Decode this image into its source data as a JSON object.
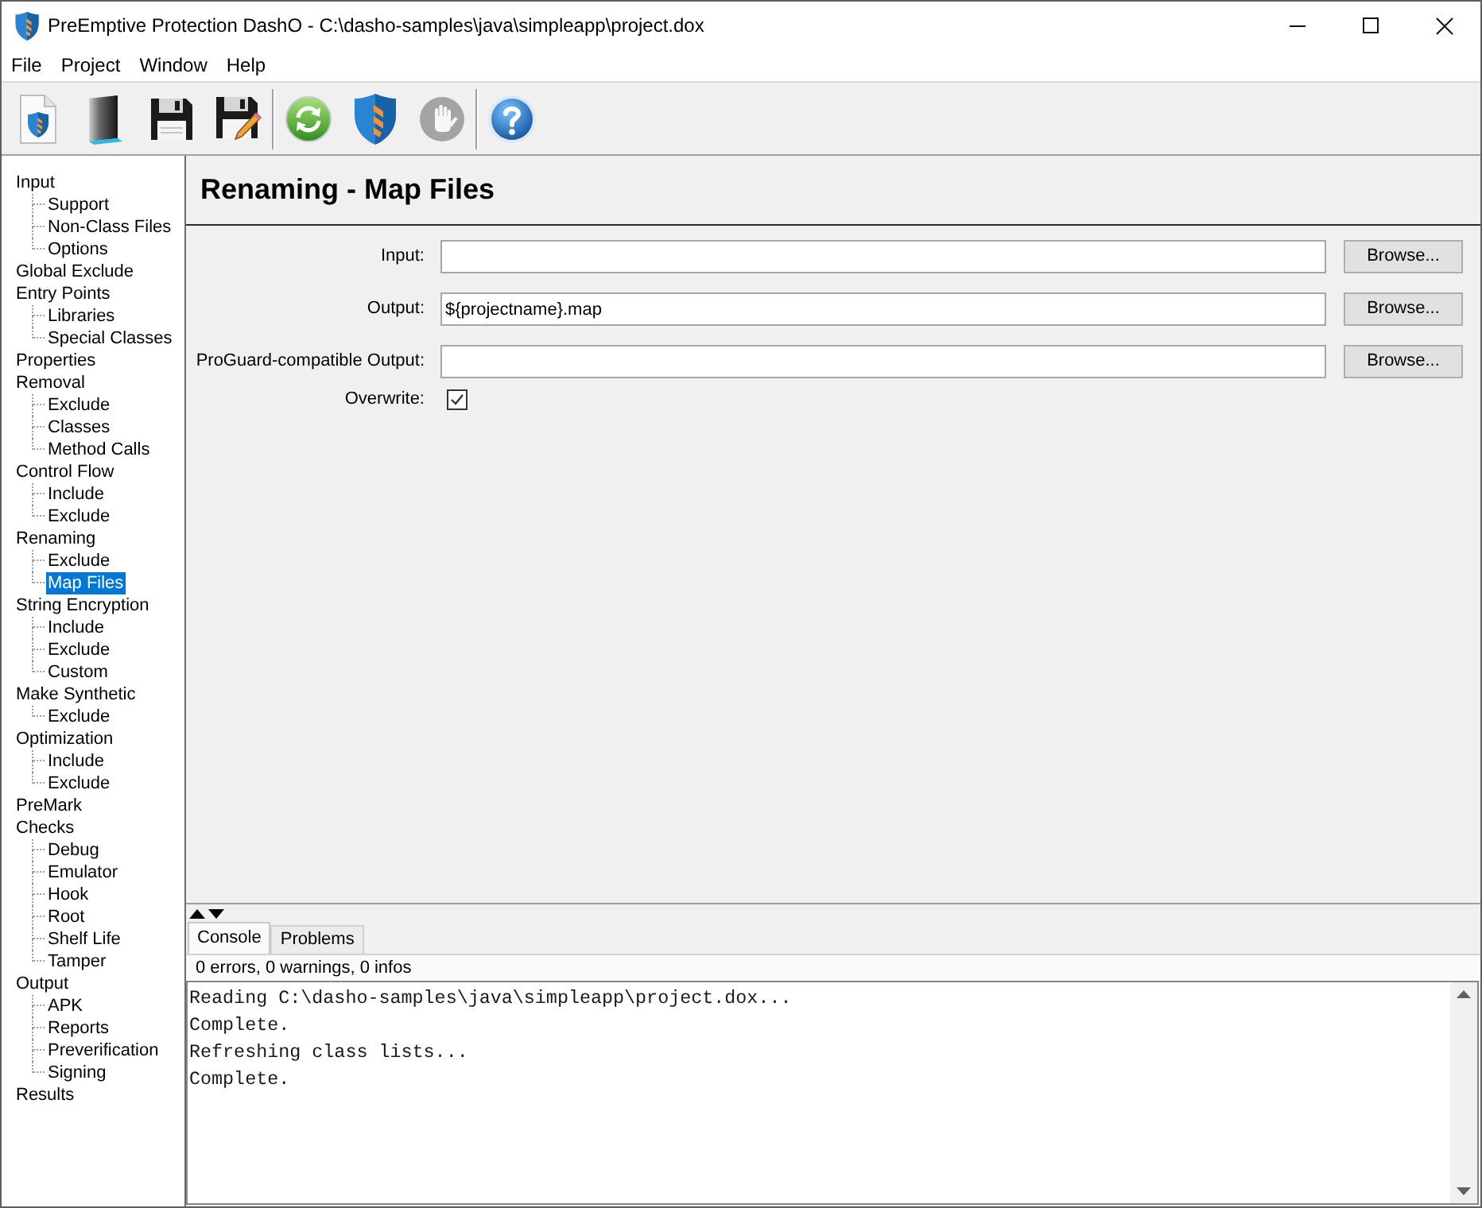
{
  "window": {
    "title": "PreEmptive Protection DashO - C:\\dasho-samples\\java\\simpleapp\\project.dox"
  },
  "menu": [
    {
      "label": "File"
    },
    {
      "label": "Project"
    },
    {
      "label": "Window"
    },
    {
      "label": "Help"
    }
  ],
  "toolbar_groups": [
    {
      "buttons": [
        {
          "kind": "new",
          "disabled": false
        },
        {
          "kind": "open",
          "disabled": false
        },
        {
          "kind": "save",
          "disabled": false
        },
        {
          "kind": "saveas",
          "disabled": false
        }
      ]
    },
    {
      "buttons": [
        {
          "kind": "refresh",
          "disabled": false
        },
        {
          "kind": "build",
          "disabled": false
        },
        {
          "kind": "stop",
          "disabled": true
        }
      ]
    },
    {
      "buttons": [
        {
          "kind": "help",
          "disabled": false
        }
      ]
    }
  ],
  "tree": [
    {
      "label": "Input",
      "selected": false,
      "children": [
        {
          "label": "Support",
          "selected": false
        },
        {
          "label": "Non-Class Files",
          "selected": false
        },
        {
          "label": "Options",
          "selected": false
        }
      ]
    },
    {
      "label": "Global Exclude",
      "selected": false
    },
    {
      "label": "Entry Points",
      "selected": false,
      "children": [
        {
          "label": "Libraries",
          "selected": false
        },
        {
          "label": "Special Classes",
          "selected": false
        }
      ]
    },
    {
      "label": "Properties",
      "selected": false
    },
    {
      "label": "Removal",
      "selected": false,
      "children": [
        {
          "label": "Exclude",
          "selected": false
        },
        {
          "label": "Classes",
          "selected": false
        },
        {
          "label": "Method Calls",
          "selected": false
        }
      ]
    },
    {
      "label": "Control Flow",
      "selected": false,
      "children": [
        {
          "label": "Include",
          "selected": false
        },
        {
          "label": "Exclude",
          "selected": false
        }
      ]
    },
    {
      "label": "Renaming",
      "selected": false,
      "children": [
        {
          "label": "Exclude",
          "selected": false
        },
        {
          "label": "Map Files",
          "selected": true
        }
      ]
    },
    {
      "label": "String Encryption",
      "selected": false,
      "children": [
        {
          "label": "Include",
          "selected": false
        },
        {
          "label": "Exclude",
          "selected": false
        },
        {
          "label": "Custom",
          "selected": false
        }
      ]
    },
    {
      "label": "Make Synthetic",
      "selected": false,
      "children": [
        {
          "label": "Exclude",
          "selected": false
        }
      ]
    },
    {
      "label": "Optimization",
      "selected": false,
      "children": [
        {
          "label": "Include",
          "selected": false
        },
        {
          "label": "Exclude",
          "selected": false
        }
      ]
    },
    {
      "label": "PreMark",
      "selected": false
    },
    {
      "label": "Checks",
      "selected": false,
      "children": [
        {
          "label": "Debug",
          "selected": false
        },
        {
          "label": "Emulator",
          "selected": false
        },
        {
          "label": "Hook",
          "selected": false
        },
        {
          "label": "Root",
          "selected": false
        },
        {
          "label": "Shelf Life",
          "selected": false
        },
        {
          "label": "Tamper",
          "selected": false
        }
      ]
    },
    {
      "label": "Output",
      "selected": false,
      "children": [
        {
          "label": "APK",
          "selected": false
        },
        {
          "label": "Reports",
          "selected": false
        },
        {
          "label": "Preverification",
          "selected": false
        },
        {
          "label": "Signing",
          "selected": false
        }
      ]
    },
    {
      "label": "Results",
      "selected": false
    }
  ],
  "page": {
    "title": "Renaming - Map Files",
    "rows": [
      {
        "kind": "file",
        "label": "Input:",
        "button": "Browse..."
      },
      {
        "kind": "file",
        "label": "Output:",
        "value": "${projectname}.map",
        "button": "Browse..."
      },
      {
        "kind": "file",
        "label": "ProGuard-compatible Output:",
        "button": "Browse..."
      },
      {
        "kind": "checkbox",
        "label": "Overwrite:",
        "checked": true
      }
    ]
  },
  "output_panel": {
    "tabs": [
      {
        "label": "Console",
        "selected": true
      },
      {
        "label": "Problems",
        "selected": false
      }
    ],
    "summary": "0 errors, 0 warnings, 0 infos",
    "console_lines": [
      "Reading C:\\dasho-samples\\java\\simpleapp\\project.dox...",
      "Complete.",
      "Refreshing class lists...",
      "Complete."
    ]
  }
}
